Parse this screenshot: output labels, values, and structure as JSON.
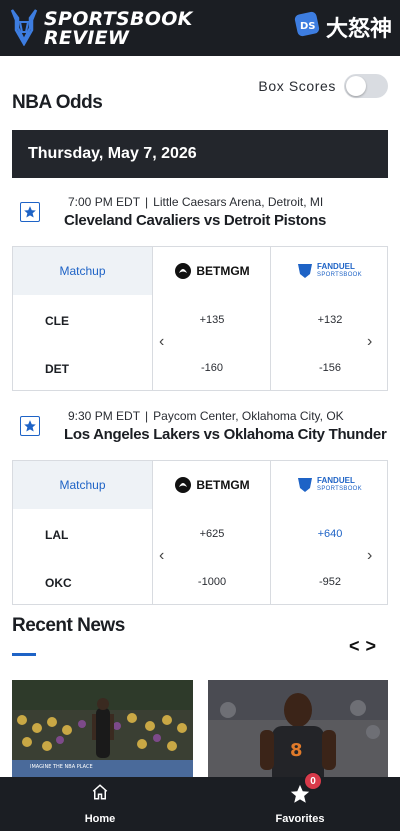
{
  "header": {
    "brand_name": "SPORTSBOOK REVIEW",
    "brand_line1": "SPORTSBOOK",
    "brand_line2": "REVIEW",
    "brand_icon": "bull-icon",
    "partner_text": "大怒神",
    "partner_icon": "ds-dice-icon"
  },
  "controls": {
    "box_scores_label": "Box Scores",
    "box_scores_on": false
  },
  "page_title": "NBA Odds",
  "date_label": "Thursday, May 7, 2026",
  "table_header": {
    "matchup_label": "Matchup",
    "book1_name": "BETMGM",
    "book1_bet": "BET",
    "book1_mgm": "MGM",
    "book2_line1": "FANDUEL",
    "book2_line2": "SPORTSBOOK"
  },
  "games": [
    {
      "time": "7:00 PM EDT",
      "separator": "|",
      "venue": "Little Caesars Arena, Detroit, MI",
      "title": "Cleveland Cavaliers vs Detroit Pistons",
      "teams": [
        {
          "abbr": "CLE",
          "betmgm": "+135",
          "fanduel": "+132"
        },
        {
          "abbr": "DET",
          "betmgm": "-160",
          "fanduel": "-156"
        }
      ]
    },
    {
      "time": "9:30 PM EDT",
      "separator": "|",
      "venue": "Paycom Center, Oklahoma City, OK",
      "title": "Los Angeles Lakers vs Oklahoma City Thunder",
      "teams": [
        {
          "abbr": "LAL",
          "betmgm": "+625",
          "fanduel": "+640"
        },
        {
          "abbr": "OKC",
          "betmgm": "-1000",
          "fanduel": "-952"
        }
      ]
    }
  ],
  "news": {
    "title": "Recent News",
    "prev": "<",
    "next": ">",
    "cards": [
      {
        "image": "basketball-player-arena-photo",
        "caption": "IMAGINE THE NBA PLACE"
      },
      {
        "image": "knicks-player-number-8-photo"
      }
    ]
  },
  "bottom_nav": {
    "home_label": "Home",
    "favorites_label": "Favorites",
    "favorites_count": "0"
  },
  "colors": {
    "dark": "#1b1e23",
    "accent_blue": "#1e63c6",
    "badge_red": "#d83a4a"
  }
}
